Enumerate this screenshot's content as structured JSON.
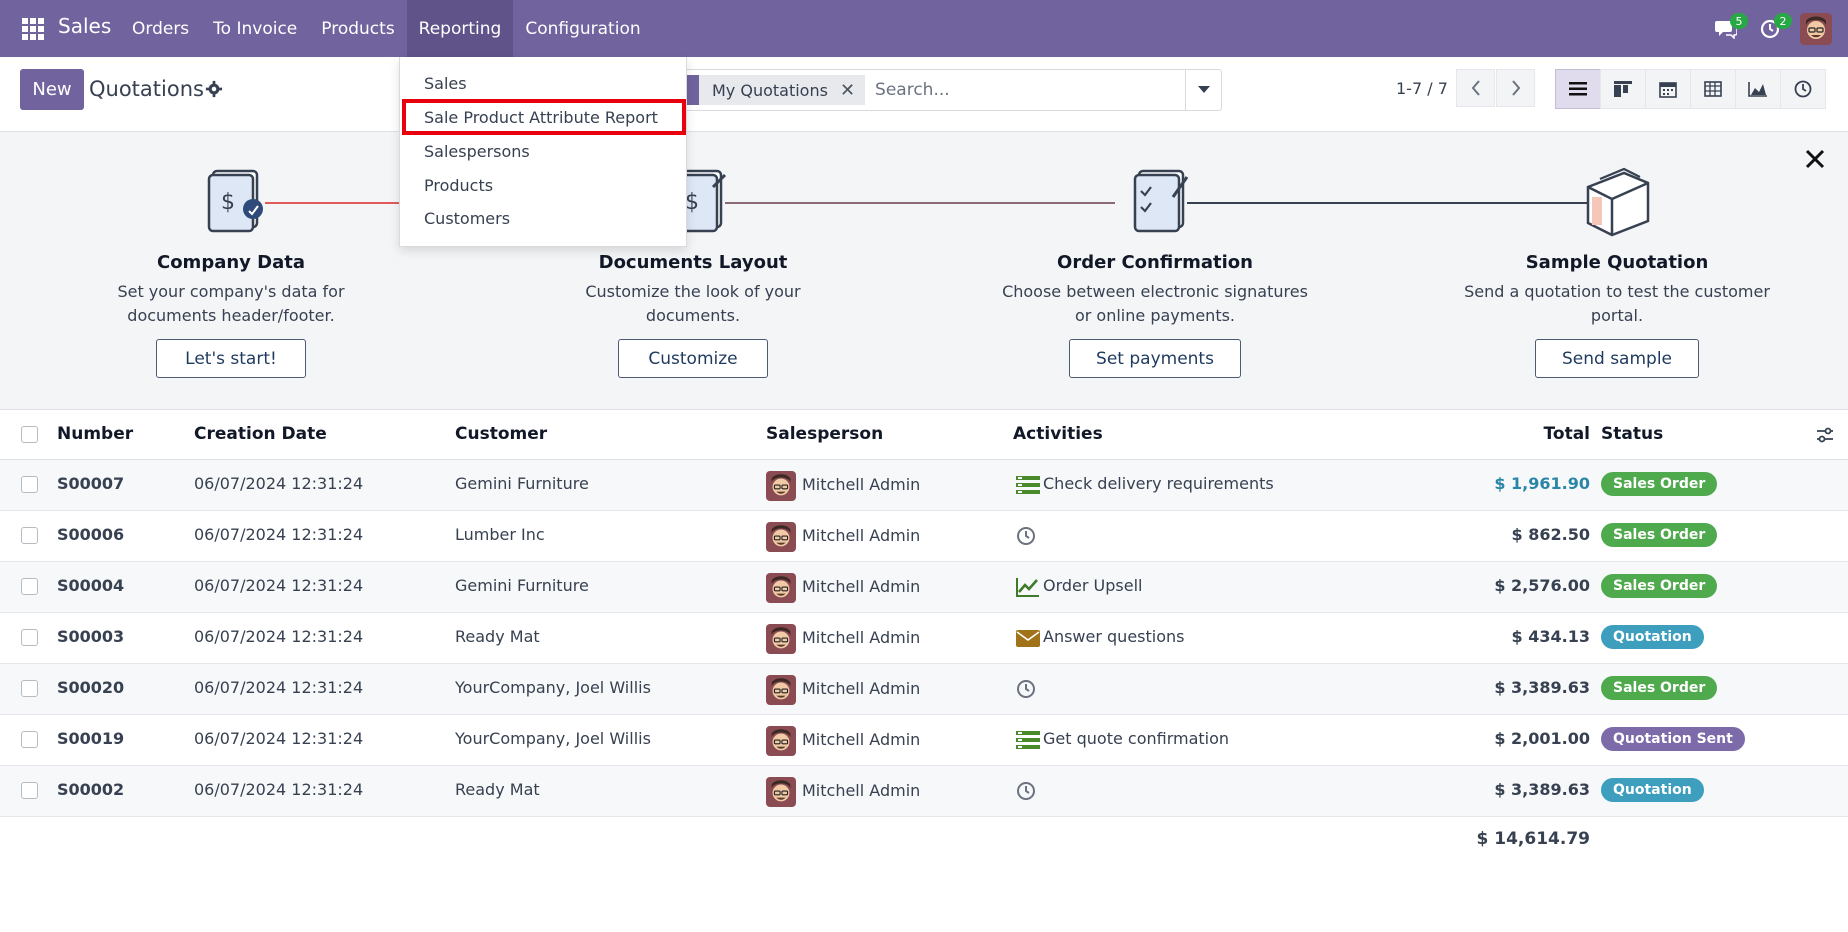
{
  "app": {
    "title": "Sales"
  },
  "nav": {
    "items": [
      "Orders",
      "To Invoice",
      "Products",
      "Reporting",
      "Configuration"
    ],
    "messages_count": "5",
    "activities_count": "2"
  },
  "control": {
    "new_label": "New",
    "page_title": "Quotations",
    "facet_label": "My Quotations",
    "search_placeholder": "Search...",
    "pager": "1-7 / 7"
  },
  "reporting_menu": {
    "items": [
      "Sales",
      "Sale Product Attribute Report",
      "Salespersons",
      "Products",
      "Customers"
    ]
  },
  "onboarding": {
    "steps": [
      {
        "title": "Company Data",
        "desc": "Set your company's data for documents header/footer.",
        "button": "Let's start!"
      },
      {
        "title": "Documents Layout",
        "desc": "Customize the look of your documents.",
        "button": "Customize"
      },
      {
        "title": "Order Confirmation",
        "desc": "Choose between electronic signatures or online payments.",
        "button": "Set payments"
      },
      {
        "title": "Sample Quotation",
        "desc": "Send a quotation to test the customer portal.",
        "button": "Send sample"
      }
    ]
  },
  "table": {
    "headers": [
      "Number",
      "Creation Date",
      "Customer",
      "Salesperson",
      "Activities",
      "Total",
      "Status"
    ],
    "rows": [
      {
        "number": "S00007",
        "date": "06/07/2024 12:31:24",
        "customer": "Gemini Furniture",
        "salesperson": "Mitchell Admin",
        "activity": "Check delivery requirements",
        "activity_icon": "tasks-icon",
        "total": "$ 1,961.90",
        "status": "Sales Order"
      },
      {
        "number": "S00006",
        "date": "06/07/2024 12:31:24",
        "customer": "Lumber Inc",
        "salesperson": "Mitchell Admin",
        "activity": "",
        "activity_icon": "clock-icon",
        "total": "$ 862.50",
        "status": "Sales Order"
      },
      {
        "number": "S00004",
        "date": "06/07/2024 12:31:24",
        "customer": "Gemini Furniture",
        "salesperson": "Mitchell Admin",
        "activity": "Order Upsell",
        "activity_icon": "upsell-chart-icon",
        "total": "$ 2,576.00",
        "status": "Sales Order"
      },
      {
        "number": "S00003",
        "date": "06/07/2024 12:31:24",
        "customer": "Ready Mat",
        "salesperson": "Mitchell Admin",
        "activity": "Answer questions",
        "activity_icon": "envelope-icon",
        "total": "$ 434.13",
        "status": "Quotation"
      },
      {
        "number": "S00020",
        "date": "06/07/2024 12:31:24",
        "customer": "YourCompany, Joel Willis",
        "salesperson": "Mitchell Admin",
        "activity": "",
        "activity_icon": "clock-icon",
        "total": "$ 3,389.63",
        "status": "Sales Order"
      },
      {
        "number": "S00019",
        "date": "06/07/2024 12:31:24",
        "customer": "YourCompany, Joel Willis",
        "salesperson": "Mitchell Admin",
        "activity": "Get quote confirmation",
        "activity_icon": "tasks-icon",
        "total": "$ 2,001.00",
        "status": "Quotation Sent"
      },
      {
        "number": "S00002",
        "date": "06/07/2024 12:31:24",
        "customer": "Ready Mat",
        "salesperson": "Mitchell Admin",
        "activity": "",
        "activity_icon": "clock-icon",
        "total": "$ 3,389.63",
        "status": "Quotation"
      }
    ],
    "sum_total": "$ 14,614.79"
  },
  "colors": {
    "brand": "#71639e",
    "status_sales_order": "#4fa94d",
    "status_quotation": "#3d9fbd",
    "status_quotation_sent": "#7c6aa9",
    "highlight": "#e8000f"
  }
}
